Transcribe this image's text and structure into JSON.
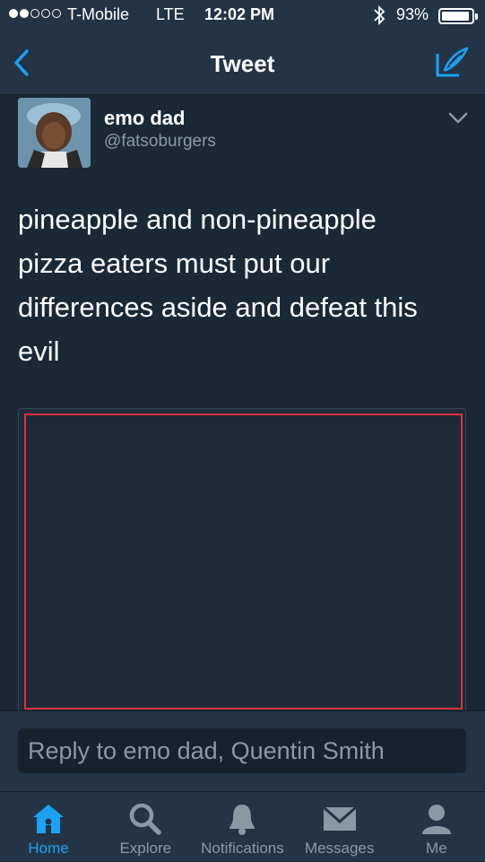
{
  "status_bar": {
    "carrier": "T-Mobile",
    "network": "LTE",
    "time": "12:02 PM",
    "battery_percent": "93%",
    "battery_level": 0.93,
    "signal_bars_filled": 2,
    "signal_bars_total": 5
  },
  "nav": {
    "title": "Tweet"
  },
  "tweet": {
    "author_name": "emo dad",
    "author_handle": "@fatsoburgers",
    "text": "pineapple and non-pineapple pizza eaters must put our differences aside and defeat this evil"
  },
  "reply": {
    "placeholder": "Reply to emo dad, Quentin Smith"
  },
  "tabs": [
    {
      "label": "Home",
      "icon": "home-icon",
      "active": true
    },
    {
      "label": "Explore",
      "icon": "search-icon",
      "active": false
    },
    {
      "label": "Notifications",
      "icon": "bell-icon",
      "active": false
    },
    {
      "label": "Messages",
      "icon": "envelope-icon",
      "active": false
    },
    {
      "label": "Me",
      "icon": "person-icon",
      "active": false
    }
  ],
  "colors": {
    "accent": "#1da1f2",
    "background": "#1b2836",
    "bar": "#243447",
    "muted_text": "#8899a6",
    "media_outline": "#d9333f"
  }
}
